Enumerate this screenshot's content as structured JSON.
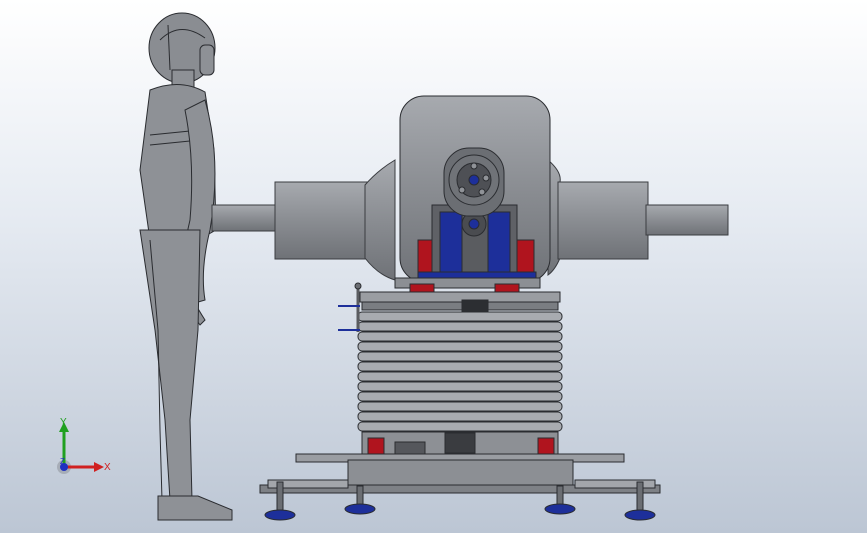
{
  "viewport": {
    "background_top": "#ffffff",
    "background_bottom": "#bcc6d4"
  },
  "model": {
    "body_color": "#8d9095",
    "outline_color": "#2a2c30",
    "accent_blue": "#1d2f9a",
    "accent_red": "#b0141e",
    "accent_green": "#2f7a3a"
  },
  "triad": {
    "x_label": "X",
    "y_label": "Y",
    "z_label": "Z",
    "x_color": "#d02020",
    "y_color": "#20a020",
    "z_color": "#2030c0"
  }
}
